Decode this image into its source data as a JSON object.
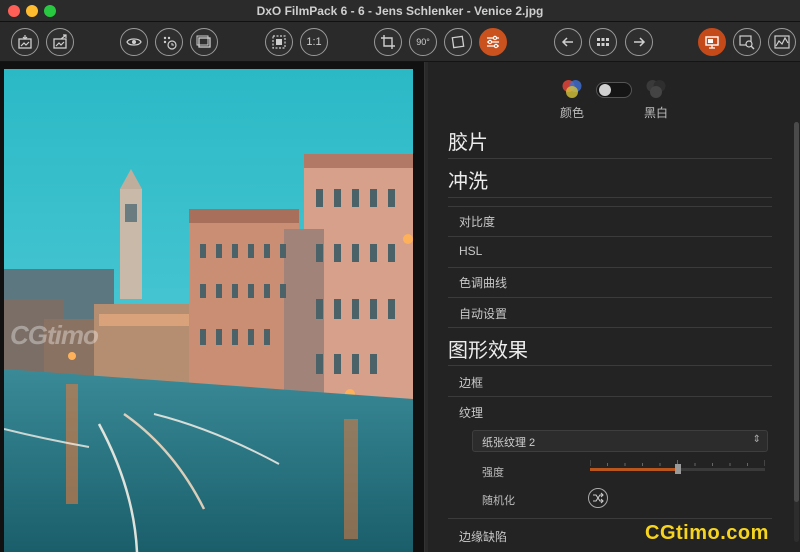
{
  "window": {
    "title": "DxO FilmPack 6 - 6 - Jens Schlenker - Venice 2.jpg"
  },
  "toolbar": {
    "buttons": [
      {
        "name": "import-icon"
      },
      {
        "name": "export-icon"
      },
      {
        "name": "preview-eye-icon"
      },
      {
        "name": "history-icon"
      },
      {
        "name": "gallery-icon"
      },
      {
        "name": "fit-screen-icon"
      },
      {
        "name": "zoom-100-icon",
        "label": "1:1"
      },
      {
        "name": "crop-icon"
      },
      {
        "name": "rotate-90-icon",
        "label": "90°"
      },
      {
        "name": "straighten-icon"
      },
      {
        "name": "adjustments-icon"
      },
      {
        "name": "prev-image-icon"
      },
      {
        "name": "grid-view-icon"
      },
      {
        "name": "next-image-icon"
      },
      {
        "name": "single-view-icon"
      },
      {
        "name": "compare-icon"
      },
      {
        "name": "histogram-icon"
      }
    ],
    "zoom_label": "1:1",
    "rotate_label": "90°"
  },
  "colors": {
    "accent": "#c9521e",
    "panel_bg": "#232323",
    "watermark": "#f7d51e"
  },
  "panel": {
    "mode_color_label": "颜色",
    "mode_bw_label": "黑白",
    "sections": {
      "film": "胶片",
      "develop": "冲洗",
      "graphic": "图形效果"
    },
    "develop_items": [
      "对比度",
      "HSL",
      "色调曲线",
      "自动设置"
    ],
    "graphic_items": {
      "border": "边框",
      "texture": "纹理",
      "texture_select": "纸张纹理 2",
      "strength_label": "强度",
      "strength_value": 0.5,
      "randomize_label": "随机化",
      "edge_defects": "边缘缺陷"
    }
  },
  "watermarks": {
    "corner": "CGtimo.com",
    "overlay": "CGtimo"
  }
}
